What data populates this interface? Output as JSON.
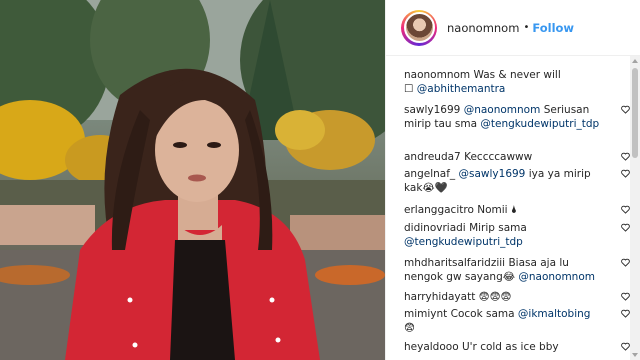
{
  "header": {
    "username": "naonomnom",
    "separator": "•",
    "follow_label": "Follow"
  },
  "comments": [
    {
      "user": "naonomnom",
      "text": "Was & never will",
      "line2_prefix": "☐ ",
      "mention": "@abhithemantra",
      "tail": "",
      "has_heart": false
    },
    {
      "user": "sawly1699",
      "mention": "@naonomnom",
      "text": "Seriusan",
      "line2": "mirip tau sma",
      "mention2": "@tengkudewiputri_tdp",
      "has_heart": true
    },
    {
      "user": "andreuda7",
      "text": "Keccccawww",
      "has_heart": true
    },
    {
      "user": "angelnaf_",
      "mention": "@sawly1699",
      "text": "iya ya mirip",
      "line2": "kak😭🖤",
      "has_heart": true
    },
    {
      "user": "erlanggacitro",
      "text": "Nomii 🌢",
      "has_heart": true
    },
    {
      "user": "didinovriadi",
      "text": "Mirip sama",
      "mention": "@tengkudewiputri_tdp",
      "has_heart": true
    },
    {
      "user": "mhdharitsalfaridziii",
      "text": "Biasa aja lu",
      "line2": "nengok gw sayang😂",
      "mention": "@naonomnom",
      "has_heart": true
    },
    {
      "user": "harryhidayatt",
      "text": "😨😨😨",
      "has_heart": true
    },
    {
      "user": "mimiynt",
      "text": "Cocok sama",
      "mention": "@ikmaltobing",
      "line2": "😨",
      "has_heart": true
    },
    {
      "user": "heyaldooo",
      "text": "U'r cold as ice bby",
      "has_heart": true
    }
  ],
  "colors": {
    "follow": "#3897f0",
    "mention": "#003569",
    "jacket": "#d32634"
  },
  "icons": {
    "like": "heart-outline-icon"
  }
}
